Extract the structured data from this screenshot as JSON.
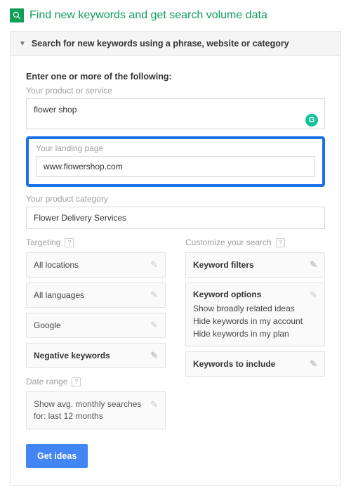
{
  "header": {
    "title": "Find new keywords and get search volume data"
  },
  "panel": {
    "title": "Search for new keywords using a phrase, website or category"
  },
  "prompt": "Enter one or more of the following:",
  "product": {
    "label": "Your product or service",
    "value": "flower shop"
  },
  "landing": {
    "label": "Your landing page",
    "value": "www.flowershop.com"
  },
  "category": {
    "label": "Your product category",
    "value": "Flower Delivery Services"
  },
  "targeting": {
    "title": "Targeting",
    "loc": "All locations",
    "lang": "All languages",
    "net": "Google",
    "neg": "Negative keywords"
  },
  "date_range": {
    "title": "Date range",
    "text": "Show avg. monthly searches for: last 12 months"
  },
  "customize": {
    "title": "Customize your search",
    "filters": "Keyword filters",
    "options_head": "Keyword options",
    "opt1": "Show broadly related ideas",
    "opt2": "Hide keywords in my account",
    "opt3": "Hide keywords in my plan",
    "include": "Keywords to include"
  },
  "cta": "Get ideas"
}
